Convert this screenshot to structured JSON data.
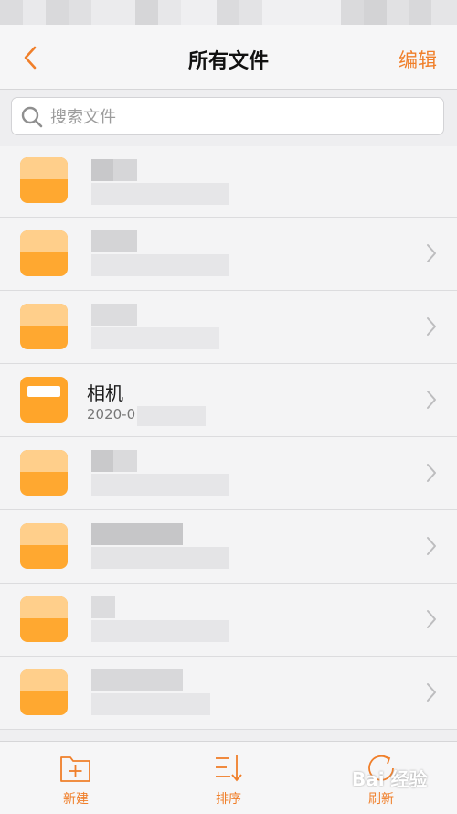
{
  "header": {
    "title": "所有文件",
    "edit_label": "编辑"
  },
  "search": {
    "placeholder": "搜索文件"
  },
  "files": [
    {
      "name": "",
      "date": ""
    },
    {
      "name": "",
      "date": ""
    },
    {
      "name": "",
      "date": ""
    },
    {
      "name": "相机",
      "date": "2020-0"
    },
    {
      "name": "",
      "date": ""
    },
    {
      "name": "",
      "date": ""
    },
    {
      "name": "",
      "date": ""
    },
    {
      "name": "",
      "date": ""
    }
  ],
  "toolbar": {
    "new_label": "新建",
    "sort_label": "排序",
    "refresh_label": "刷新"
  },
  "watermark": {
    "text": "Bai 经验"
  },
  "colors": {
    "accent": "#f07f2a",
    "folder": "#ffa830"
  },
  "icons": [
    "back-chevron-icon",
    "search-icon",
    "folder-icon",
    "chevron-right-icon",
    "new-folder-icon",
    "sort-icon",
    "refresh-icon"
  ]
}
